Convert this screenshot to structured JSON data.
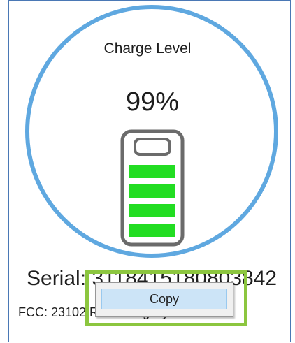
{
  "widget": {
    "title": "Charge Level",
    "percent_text": "99%",
    "charge_fraction": 0.99,
    "serial_text": "Serial: 3118415180803842",
    "fcc_text": "FCC: 23102 Remaining Cycles: 3379"
  },
  "context_menu": {
    "items": [
      {
        "label": "Copy"
      }
    ]
  },
  "colors": {
    "ring": "#5fa8e0",
    "battery_outline": "#6b6b6b",
    "battery_bar": "#22dd22",
    "highlight": "#8cc63f",
    "menu_hover": "#cce4f7"
  },
  "icons": {
    "battery": "battery-icon"
  }
}
